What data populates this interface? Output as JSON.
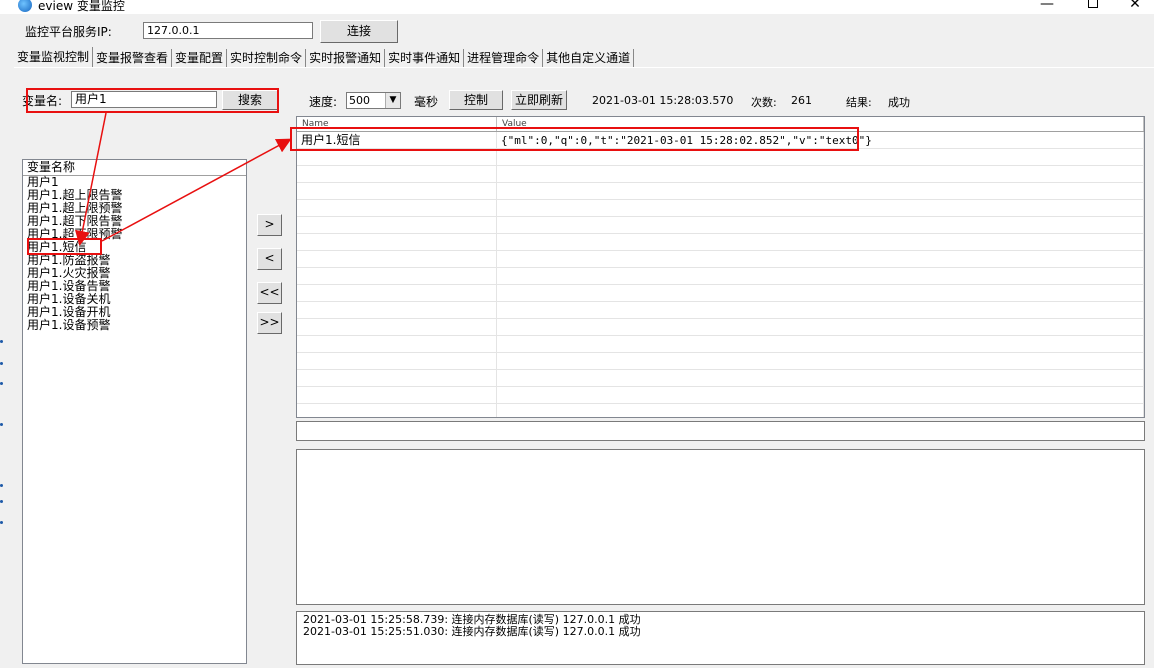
{
  "window": {
    "title": "eview 变量监控",
    "minimize": "—",
    "close": "✕"
  },
  "server": {
    "label": "监控平台服务IP:",
    "ip_value": "127.0.0.1",
    "connect_label": "连接"
  },
  "tabs": [
    "变量监视控制",
    "变量报警查看",
    "变量配置",
    "实时控制命令",
    "实时报警通知",
    "实时事件通知",
    "进程管理命令",
    "其他自定义通道"
  ],
  "search": {
    "label": "变量名:",
    "value": "用户1",
    "button": "搜索"
  },
  "variable_list": {
    "header": "变量名称",
    "items": [
      "用户1",
      "用户1.超上限告警",
      "用户1.超上限预警",
      "用户1.超下限告警",
      "用户1.超下限预警",
      "用户1.短信",
      "用户1.防盗报警",
      "用户1.火灾报警",
      "用户1.设备告警",
      "用户1.设备关机",
      "用户1.设备开机",
      "用户1.设备预警"
    ]
  },
  "transfer_buttons": {
    "add": ">",
    "remove": "<",
    "remove_all": "<<",
    "add_all": ">>"
  },
  "toolbar": {
    "speed_label": "速度:",
    "speed_value": "500",
    "unit_label": "毫秒",
    "control_button": "控制",
    "refresh_button": "立即刷新",
    "timestamp": "2021-03-01 15:28:03.570",
    "count_label": "次数:",
    "count_value": "261",
    "result_label": "结果:",
    "result_value": "成功"
  },
  "monitor_table": {
    "columns": [
      "Name",
      "Value"
    ],
    "rows": [
      {
        "name": "用户1.短信",
        "value": "{\"ml\":0,\"q\":0,\"t\":\"2021-03-01 15:28:02.852\",\"v\":\"text0\"}"
      }
    ]
  },
  "log": [
    "2021-03-01 15:25:58.739: 连接内存数据库(读写) 127.0.0.1 成功",
    "2021-03-01 15:25:51.030: 连接内存数据库(读写) 127.0.0.1 成功"
  ],
  "colors": {
    "annotation_red": "#e81010",
    "window_bg": "#f0f0f0"
  },
  "icons": {
    "app": "eview-app-icon",
    "dropdown": "chevron-down-icon"
  }
}
